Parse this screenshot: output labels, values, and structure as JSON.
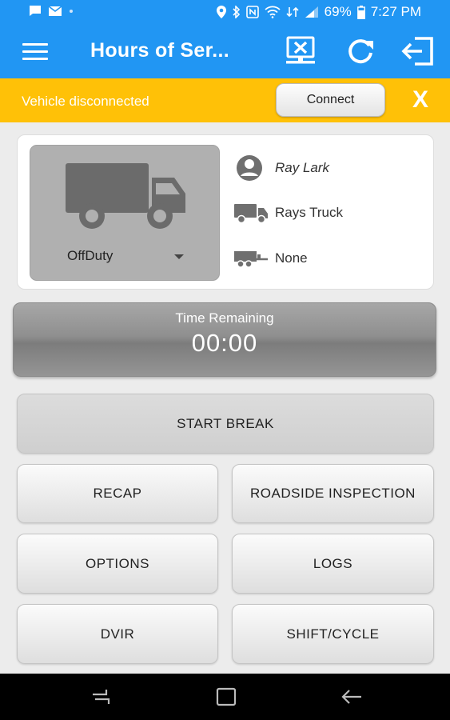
{
  "status_bar": {
    "battery": "69%",
    "time": "7:27 PM",
    "left_icons": [
      "message-icon",
      "email-icon",
      "dot-icon"
    ],
    "right_icons": [
      "location-icon",
      "bluetooth-icon",
      "nfc-icon",
      "wifi-icon",
      "data-icon",
      "signal-icon",
      "battery-icon"
    ]
  },
  "app_bar": {
    "title": "Hours of Ser...",
    "icons": [
      "menu-icon",
      "disconnected-device-icon",
      "refresh-icon",
      "logout-icon"
    ]
  },
  "banner": {
    "message": "Vehicle disconnected",
    "connect_label": "Connect",
    "close_label": "X",
    "color": "#ffc107"
  },
  "driver_card": {
    "duty_status": "OffDuty",
    "driver_name": "Ray Lark",
    "vehicle": "Rays Truck",
    "trailer": "None"
  },
  "time_remaining": {
    "label": "Time Remaining",
    "value": "00:00"
  },
  "buttons": {
    "start_break": "START BREAK",
    "recap": "RECAP",
    "roadside_inspection": "ROADSIDE INSPECTION",
    "options": "OPTIONS",
    "logs": "LOGS",
    "dvir": "DVIR",
    "shift_cycle": "SHIFT/CYCLE"
  },
  "nav_bar": {
    "icons": [
      "recents-icon",
      "home-icon",
      "back-icon"
    ]
  },
  "colors": {
    "primary": "#2196f3",
    "warning": "#ffc107",
    "background": "#ececec"
  }
}
